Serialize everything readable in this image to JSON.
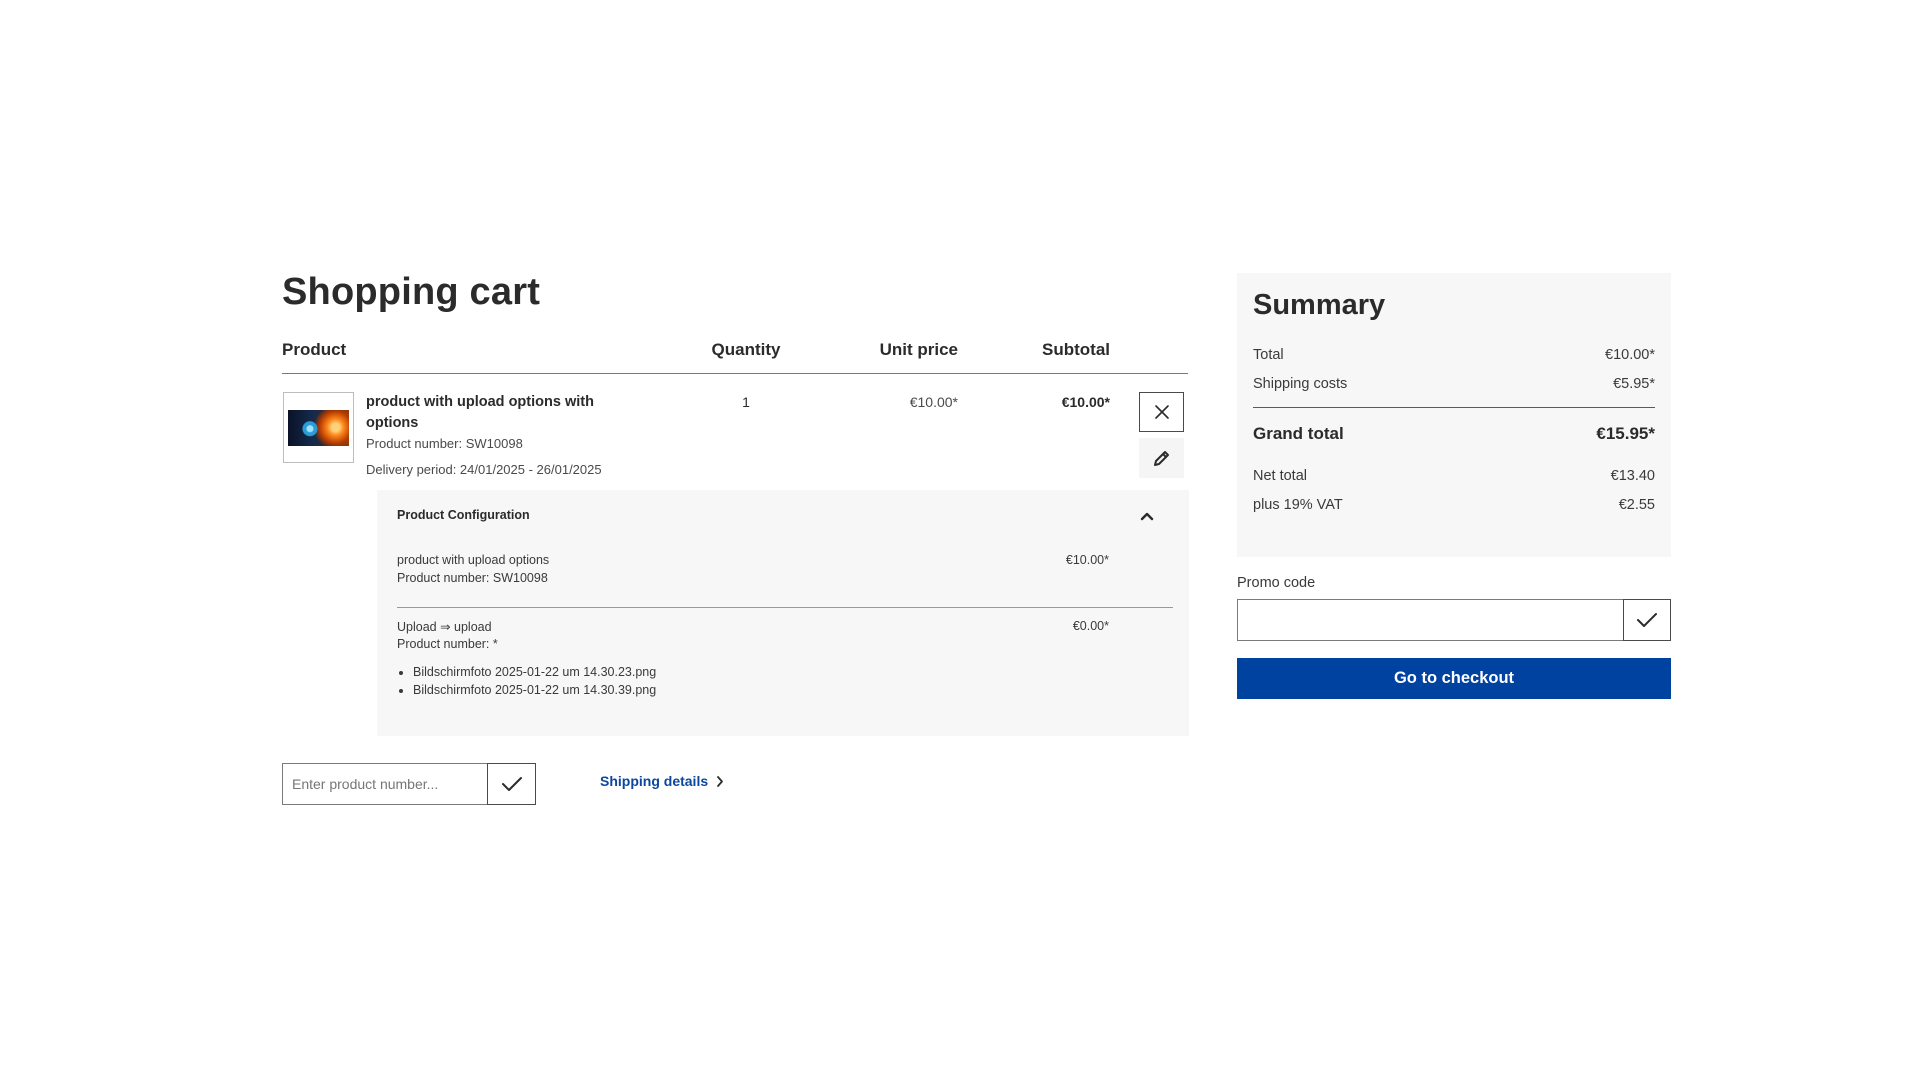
{
  "page": {
    "title": "Shopping cart"
  },
  "cart": {
    "headers": {
      "product": "Product",
      "quantity": "Quantity",
      "unit_price": "Unit price",
      "subtotal": "Subtotal"
    },
    "item": {
      "name": "product with upload options with options",
      "product_number": "Product number: SW10098",
      "delivery": "Delivery period: 24/01/2025 - 26/01/2025",
      "quantity": "1",
      "unit_price": "€10.00*",
      "subtotal": "€10.00*",
      "remove_icon": "close-icon",
      "edit_icon": "pencil-icon"
    },
    "configuration": {
      "title": "Product Configuration",
      "toggle_icon": "chevron-up-icon",
      "rows": [
        {
          "name": "product with upload options",
          "product_number": "Product number: SW10098",
          "price": "€10.00*"
        },
        {
          "name": "Upload ⇒ upload",
          "product_number": "Product number: *",
          "price": "€0.00*",
          "files": [
            "Bildschirmfoto 2025-01-22 um 14.30.23.png",
            "Bildschirmfoto 2025-01-22 um 14.30.39.png"
          ]
        }
      ]
    },
    "quick_add": {
      "placeholder": "Enter product number...",
      "submit_icon": "checkmark-icon"
    },
    "shipping_link": {
      "label": "Shipping details",
      "icon": "chevron-right-icon"
    }
  },
  "summary": {
    "title": "Summary",
    "total_label": "Total",
    "total_value": "€10.00*",
    "shipping_label": "Shipping costs",
    "shipping_value": "€5.95*",
    "grand_total_label": "Grand total",
    "grand_total_value": "€15.95*",
    "net_total_label": "Net total",
    "net_total_value": "€13.40",
    "vat_label": "plus 19% VAT",
    "vat_value": "€2.55"
  },
  "promo": {
    "label": "Promo code",
    "value": "",
    "submit_icon": "checkmark-icon"
  },
  "checkout": {
    "label": "Go to checkout"
  },
  "colors": {
    "primary": "#0042a0",
    "link": "#0b47a0",
    "text": "#2b2b2b",
    "panel_bg": "#f7f7f7"
  }
}
